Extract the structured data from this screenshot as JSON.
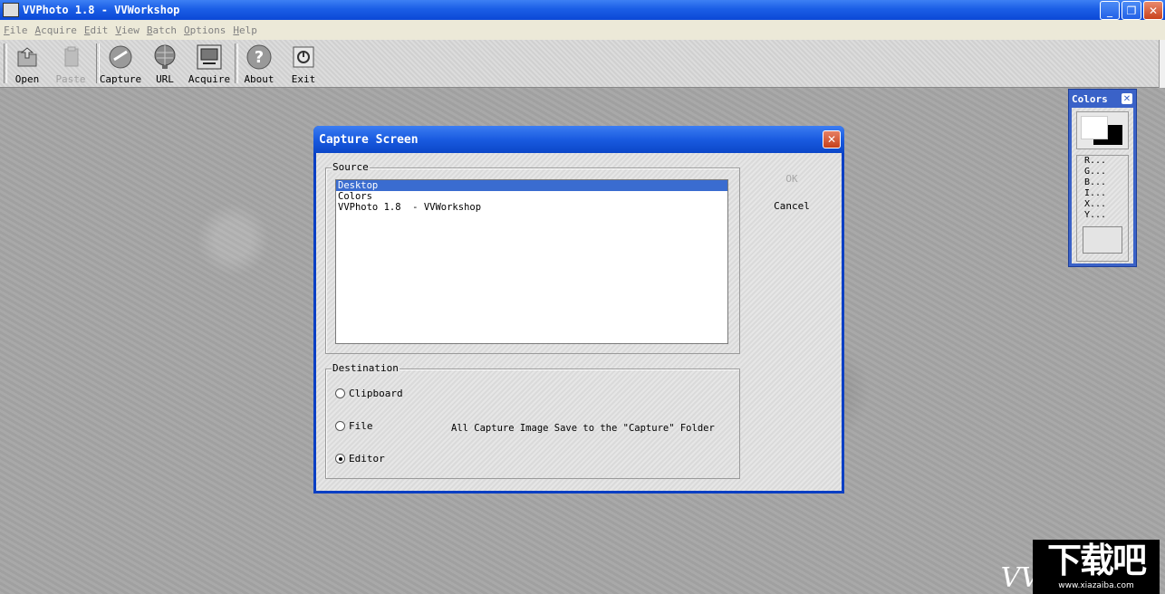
{
  "window": {
    "title": "VVPhoto 1.8  - VVWorkshop",
    "controls": {
      "minimize": "_",
      "restore": "❐",
      "close": "✕"
    }
  },
  "menu": [
    {
      "label": "File",
      "key": "F",
      "rest": "ile"
    },
    {
      "label": "Acquire",
      "key": "A",
      "rest": "cquire"
    },
    {
      "label": "Edit",
      "key": "E",
      "rest": "dit"
    },
    {
      "label": "View",
      "key": "V",
      "rest": "iew"
    },
    {
      "label": "Batch",
      "key": "B",
      "rest": "atch"
    },
    {
      "label": "Options",
      "key": "O",
      "rest": "ptions"
    },
    {
      "label": "Help",
      "key": "H",
      "rest": "elp"
    }
  ],
  "toolbar": {
    "open": {
      "label": "Open",
      "icon": "open-folder-icon"
    },
    "paste": {
      "label": "Paste",
      "icon": "paste-icon",
      "enabled": false
    },
    "capture": {
      "label": "Capture",
      "icon": "camera-capture-icon"
    },
    "url": {
      "label": "URL",
      "icon": "globe-icon"
    },
    "acquire": {
      "label": "Acquire",
      "icon": "scanner-icon"
    },
    "about": {
      "label": "About",
      "icon": "question-icon"
    },
    "exit": {
      "label": "Exit",
      "icon": "power-icon"
    }
  },
  "dialog": {
    "title": "Capture Screen",
    "close": "✕",
    "source": {
      "label": "Source",
      "items": [
        "Desktop",
        "Colors",
        "VVPhoto 1.8  - VVWorkshop"
      ],
      "selected_index": 0
    },
    "destination": {
      "label": "Destination",
      "options": [
        "Clipboard",
        "File",
        "Editor"
      ],
      "selected": "Editor",
      "note": "All Capture Image Save to the \"Capture\" Folder"
    },
    "ok": "OK",
    "cancel": "Cancel"
  },
  "colors_panel": {
    "title": "Colors",
    "close": "✕",
    "foreground": "#ffffff",
    "background": "#000000",
    "lines": [
      "R...",
      "G...",
      "B...",
      "I...",
      "X...",
      "Y..."
    ]
  },
  "watermark": {
    "text": "下载吧",
    "url": "www.xiazaiba.com",
    "partial": "VV"
  },
  "colors": {
    "titlebar": "#1b5ee6",
    "selection": "#3a6cd0"
  }
}
